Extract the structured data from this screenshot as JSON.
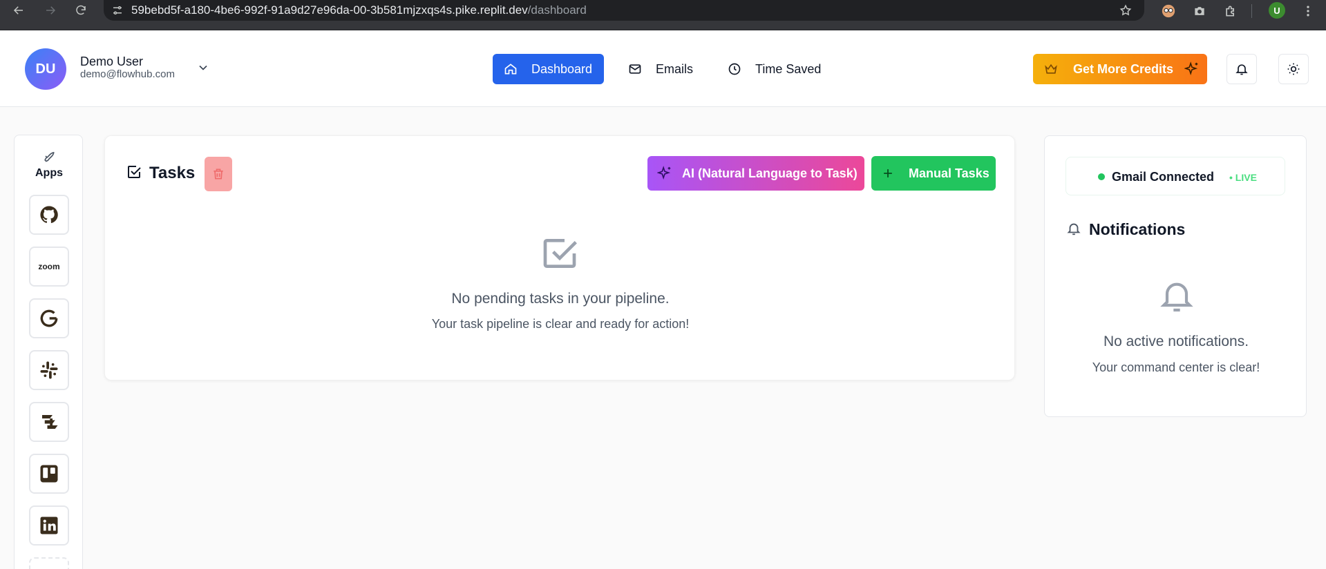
{
  "browser": {
    "url_host": "59bebd5f-a180-4be6-992f-91a9d27e96da-00-3b581mjzxqs4s.pike.replit.dev",
    "url_path": "/dashboard",
    "profile_initial": "U"
  },
  "user": {
    "initials": "DU",
    "name": "Demo User",
    "email": "demo@flowhub.com"
  },
  "nav": {
    "tabs": [
      {
        "label": "Dashboard",
        "icon": "home-icon",
        "active": true
      },
      {
        "label": "Emails",
        "icon": "mail-icon",
        "active": false
      },
      {
        "label": "Time Saved",
        "icon": "clock-icon",
        "active": false
      }
    ]
  },
  "header_actions": {
    "credits_label": "Get More Credits"
  },
  "apps": {
    "label": "Apps",
    "items": [
      {
        "name": "github",
        "icon": "github-icon"
      },
      {
        "name": "zoom",
        "icon": "zoom-icon",
        "text": "zoom"
      },
      {
        "name": "google",
        "icon": "google-icon"
      },
      {
        "name": "slack",
        "icon": "slack-icon"
      },
      {
        "name": "jira",
        "icon": "jira-icon"
      },
      {
        "name": "trello",
        "icon": "trello-icon"
      },
      {
        "name": "linkedin",
        "icon": "linkedin-icon"
      }
    ]
  },
  "tasks": {
    "title": "Tasks",
    "ai_button_label": "AI (Natural Language to Task)",
    "manual_button_label": "Manual Tasks",
    "empty_title": "No pending tasks in your pipeline.",
    "empty_subtitle": "Your task pipeline is clear and ready for action!"
  },
  "right_panel": {
    "gmail_status": "Gmail Connected",
    "live_label": "• LIVE",
    "notifications_title": "Notifications",
    "empty_title": "No active notifications.",
    "empty_subtitle": "Your command center is clear!"
  },
  "colors": {
    "primary": "#2563eb",
    "success": "#22c55e",
    "credits_start": "#f5b00b",
    "credits_end": "#f97316",
    "ai_start": "#a855f7",
    "ai_end": "#ec4899"
  }
}
